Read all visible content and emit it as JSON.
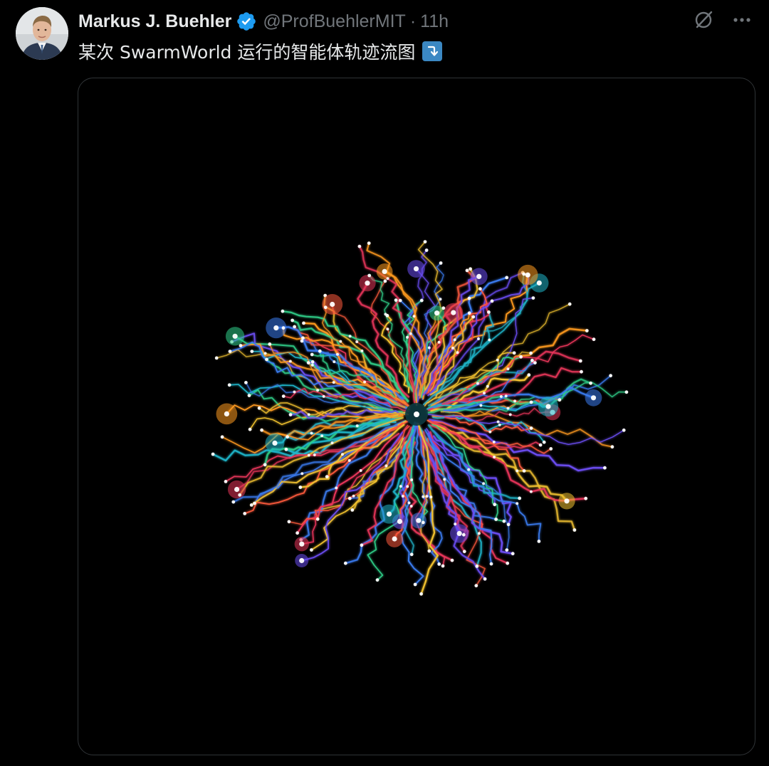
{
  "tweet": {
    "author": {
      "display_name": "Markus J. Buehler",
      "handle": "@ProfBuehlerMIT",
      "verified": true,
      "avatar_icon": "profile-photo"
    },
    "separator": "·",
    "timestamp": "11h",
    "text": "某次 SwarmWorld 运行的智能体轨迹流图",
    "text_emoji": "right-arrow-curving-down-icon",
    "actions": {
      "grok_icon": "grok-icon",
      "more_icon": "more-dots-icon"
    },
    "media": {
      "type": "animated-gif",
      "background": "#000000",
      "palette": [
        "#ff5a3c",
        "#ff9a1f",
        "#f2c230",
        "#2fd08a",
        "#1fb5c9",
        "#3a7bf0",
        "#6a4cf0",
        "#e8355a"
      ]
    }
  },
  "colors": {
    "background": "#000000",
    "text_primary": "#e7e9ea",
    "text_secondary": "#71767b",
    "verified_blue": "#1d9bf0",
    "border": "#2f3336"
  }
}
